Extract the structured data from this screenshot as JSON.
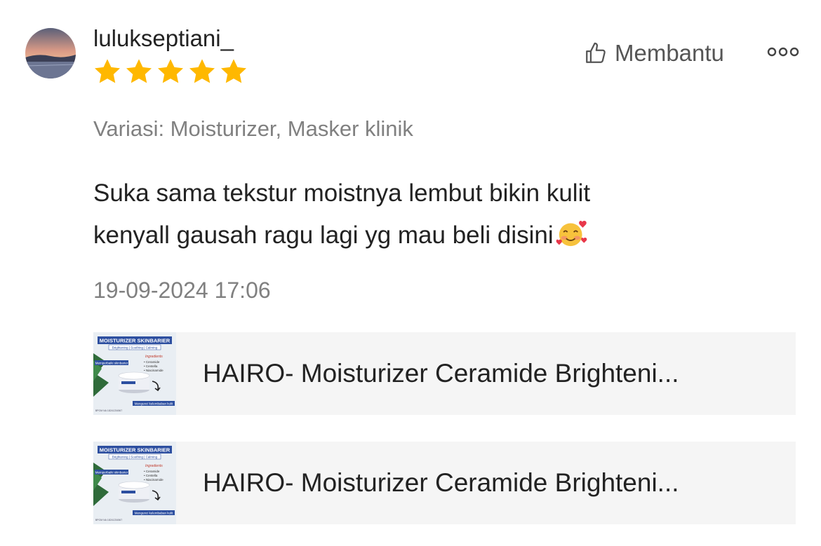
{
  "review": {
    "username": "lulukseptiani_",
    "rating": 5,
    "rating_max": 5,
    "helpful_label": "Membantu",
    "variation": "Variasi: Moisturizer, Masker klinik",
    "comment_line1": "Suka sama tekstur moistnya lembut bikin kulit",
    "comment_line2": "kenyall gausah ragu lagi yg mau beli disini",
    "comment_emoji": "smiling-face-with-hearts",
    "date": "19-09-2024 17:06"
  },
  "products": [
    {
      "title": "HAIRO- Moisturizer Ceramide Brighteni...",
      "thumb": {
        "headline": "MOISTURIZER SKINBARIER",
        "subline": "Brightening | Soothing | Calming",
        "ingredients_heading": "Ingredients",
        "ingredients": [
          "• Ceramide",
          "• Centella",
          "• Niacinamide"
        ],
        "left_label": "Memperbaiki skinbarier",
        "bottom_label": "Mengunci kelembaban kulit",
        "footer": "BPOM NA 18241234567"
      }
    },
    {
      "title": "HAIRO- Moisturizer Ceramide Brighteni...",
      "thumb": {
        "headline": "MOISTURIZER SKINBARIER",
        "subline": "Brightening | Soothing | Calming",
        "ingredients_heading": "Ingredients",
        "ingredients": [
          "• Ceramide",
          "• Centella",
          "• Niacinamide"
        ],
        "left_label": "Memperbaiki skinbarier",
        "bottom_label": "Mengunci kelembaban kulit",
        "footer": "BPOM NA 18241234567"
      }
    }
  ],
  "colors": {
    "star": "#FFB800",
    "muted_text": "#808080",
    "product_bg": "#F5F5F5",
    "thumb_blue": "#2D4FA0"
  },
  "icons": {
    "helpful": "thumbs-up-icon",
    "more": "more-options-icon",
    "star": "star-icon"
  }
}
